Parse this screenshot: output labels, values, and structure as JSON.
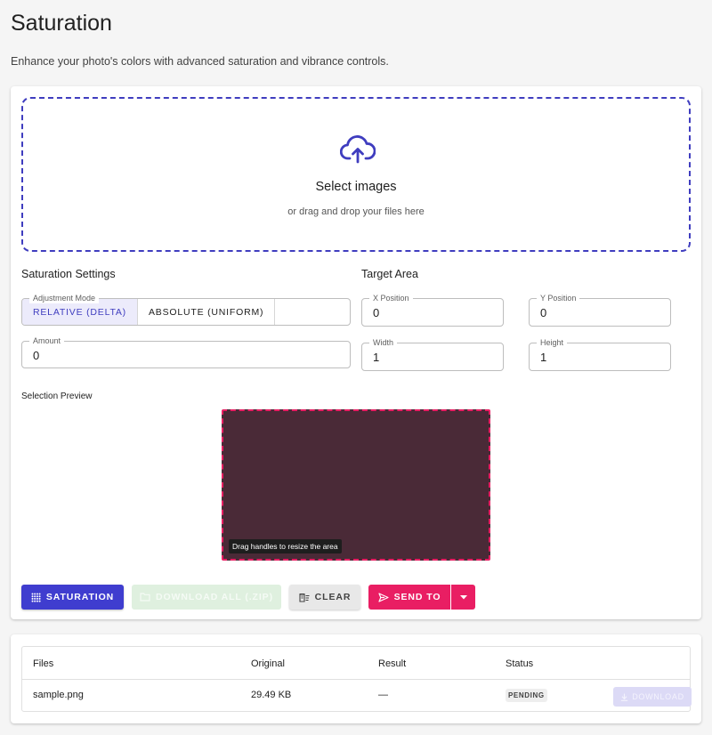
{
  "page": {
    "title": "Saturation",
    "subtitle": "Enhance your photo's colors with advanced saturation and vibrance controls."
  },
  "dropzone": {
    "icon": "cloud-upload-icon",
    "title": "Select images",
    "subtitle": "or drag and drop your files here",
    "border_color": "#3f3dbf"
  },
  "settings": {
    "section_label": "Saturation Settings",
    "adjustment_mode": {
      "label": "Adjustment Mode",
      "options": [
        "RELATIVE (DELTA)",
        "ABSOLUTE (UNIFORM)"
      ],
      "selected": "RELATIVE (DELTA)"
    },
    "amount": {
      "label": "Amount",
      "value": "0"
    }
  },
  "target": {
    "section_label": "Target Area",
    "x": {
      "label": "X Position",
      "value": "0"
    },
    "y": {
      "label": "Y Position",
      "value": "0"
    },
    "width": {
      "label": "Width",
      "value": "1"
    },
    "height": {
      "label": "Height",
      "value": "1"
    }
  },
  "preview": {
    "label": "Selection Preview",
    "tooltip": "Drag handles to resize the area",
    "fill_color": "#4a2a37",
    "border_color": "#e91e63"
  },
  "actions": {
    "saturation": "SATURATION",
    "download_all": "DOWNLOAD ALL (.ZIP)",
    "clear": "CLEAR",
    "send_to": "SEND TO",
    "primary_color": "#3f3dcf",
    "send_color": "#e91e63"
  },
  "files": {
    "headers": [
      "Files",
      "Original",
      "Result",
      "Status"
    ],
    "rows": [
      {
        "name": "sample.png",
        "original": "29.49 KB",
        "result": "—",
        "status": "PENDING",
        "action": "DOWNLOAD"
      }
    ]
  }
}
